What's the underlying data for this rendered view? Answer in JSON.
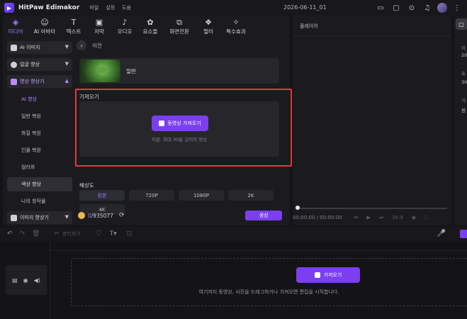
{
  "app": {
    "name": "HitPaw Edimakor",
    "menus": [
      "파일",
      "설정",
      "도움"
    ],
    "document_title": "2026-06-11_01"
  },
  "colors": {
    "accent": "#7b3ff0",
    "accent_text": "#a87cff",
    "highlight_border": "#e03a3a",
    "background": "#141417",
    "panel": "#1b1b1f"
  },
  "toolbar_icons": [
    "layout-icon",
    "feedback-icon",
    "download-icon",
    "notification-icon",
    "avatar"
  ],
  "tabs": [
    {
      "label": "미디어",
      "icon": "media-icon",
      "active": true
    },
    {
      "label": "AI 아바타",
      "icon": "avatar-ai-icon",
      "active": false
    },
    {
      "label": "텍스트",
      "icon": "text-icon",
      "active": false
    },
    {
      "label": "자막",
      "icon": "subtitle-icon",
      "active": false
    },
    {
      "label": "오디오",
      "icon": "audio-icon",
      "active": false
    },
    {
      "label": "요소들",
      "icon": "elements-icon",
      "active": false
    },
    {
      "label": "화면전환",
      "icon": "transition-icon",
      "active": false
    },
    {
      "label": "필터",
      "icon": "filter-icon",
      "active": false
    },
    {
      "label": "특수효과",
      "icon": "effects-icon",
      "active": false
    }
  ],
  "sidebar": {
    "groups": [
      {
        "label": "AI 이미지"
      },
      {
        "label": "얼굴 향상"
      },
      {
        "label": "영상 향상기"
      }
    ],
    "subitems": [
      {
        "label": "AI 향상"
      },
      {
        "label": "일반 복원"
      },
      {
        "label": "화질 복원"
      },
      {
        "label": "인물 복원"
      },
      {
        "label": "컬러화"
      },
      {
        "label": "색상 향상"
      },
      {
        "label": "나의 창작물"
      }
    ],
    "bottom_group": {
      "label": "이미지 향상기"
    }
  },
  "content": {
    "back_label": "이전",
    "model_label": "일반",
    "import_title": "가져오기",
    "import_button": "동영상 가져오기",
    "import_hint": "지원: 최대 30분 길이의 영상",
    "resolution_title": "해상도",
    "resolutions": [
      "원본",
      "720P",
      "1080P",
      "2K",
      "4K"
    ],
    "credits_used": "0",
    "credits_total": "/935077",
    "generate_button": "생성"
  },
  "player": {
    "title": "플레이어",
    "time_current": "00:00:00",
    "time_total": "00:00:00",
    "ratio": "16:9"
  },
  "props": {
    "lines": [
      "이",
      "20",
      "프",
      "30",
      "거",
      "원"
    ]
  },
  "timeline": {
    "toolbar_split_label": "분리하기",
    "import_button": "가져오기",
    "hint": "여기까지 동영상, 사진을 드래그하거나 가져오면 편집을 시작합니다."
  }
}
